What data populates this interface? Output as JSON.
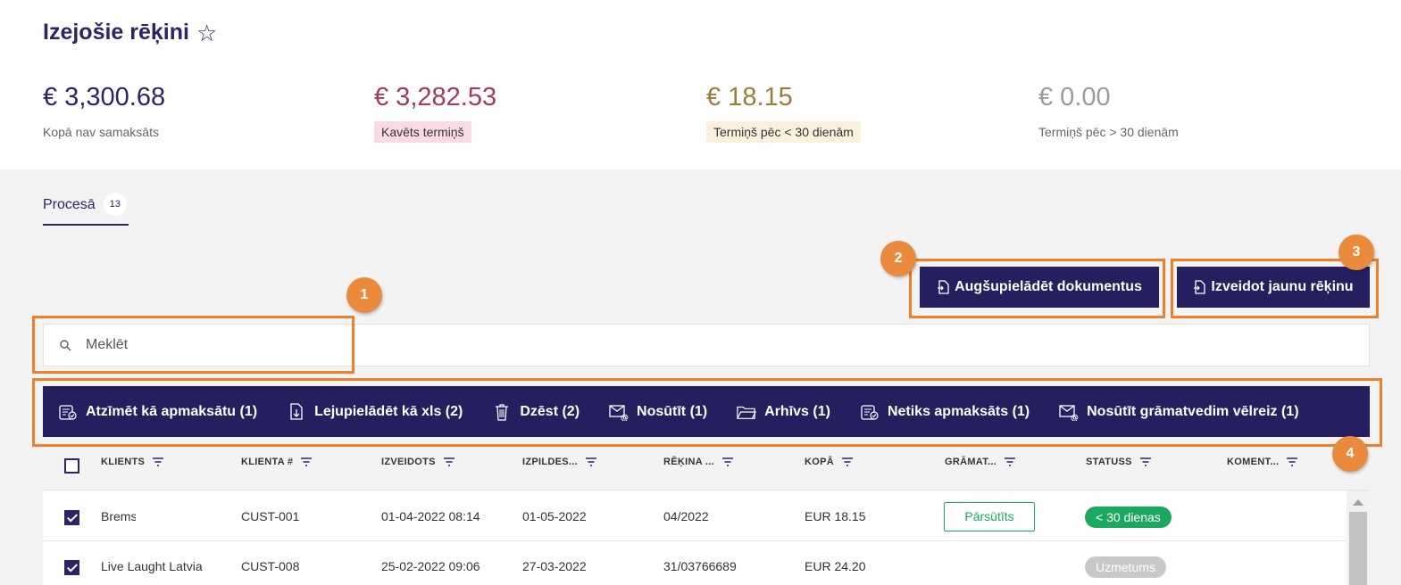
{
  "page": {
    "title": "Izejošie rēķini",
    "favorite_icon": "star-outline-icon"
  },
  "stats": [
    {
      "amount": "€ 3,300.68",
      "label": "Kopā nav samaksāts"
    },
    {
      "amount": "€ 3,282.53",
      "label": "Kavēts termiņš",
      "color": "#a33c52",
      "badge_bg": "#fadbe3"
    },
    {
      "amount": "€ 18.15",
      "label": "Termiņš pēc < 30 dienām",
      "color": "#9a7d3a",
      "badge_bg": "#fbf0dc"
    },
    {
      "amount": "€ 0.00",
      "label": "Termiņš pēc > 30 dienām"
    }
  ],
  "tabs": [
    {
      "label": "Procesā",
      "count": "13"
    }
  ],
  "buttons": {
    "upload": "Augšupielādēt dokumentus",
    "create": "Izveidot jaunu rēķinu"
  },
  "search": {
    "placeholder": "Meklēt"
  },
  "actions": [
    {
      "label": "Atzīmēt kā apmaksātu (1)",
      "icon": "mark-paid-icon"
    },
    {
      "label": "Lejupielādēt kā xls (2)",
      "icon": "download-xls-icon"
    },
    {
      "label": "Dzēst (2)",
      "icon": "trash-icon"
    },
    {
      "label": "Nosūtīt (1)",
      "icon": "email-send-icon"
    },
    {
      "label": "Arhīvs (1)",
      "icon": "folder-icon"
    },
    {
      "label": "Netiks apmaksāts (1)",
      "icon": "not-paid-icon"
    },
    {
      "label": "Nosūtīt grāmatvedim vēlreiz (1)",
      "icon": "email-resend-icon"
    }
  ],
  "table": {
    "columns": [
      "KLIENTS",
      "KLIENTA #",
      "IZVEIDOTS",
      "IZPILDES...",
      "RĒĶINA ...",
      "KOPĀ",
      "GRĀMAT...",
      "STATUSS",
      "KOMENT..."
    ],
    "rows": [
      {
        "checked": true,
        "client": "Brems",
        "client_no": "CUST-001",
        "created": "01-04-2022 08:14",
        "due": "01-05-2022",
        "invoice": "04/2022",
        "total": "EUR 18.15",
        "accounting": "Pārsūtīts",
        "status": "< 30 dienas",
        "status_color": "#1da862",
        "comment": ""
      },
      {
        "checked": true,
        "client": "Live Laught Latvia",
        "client_no": "CUST-008",
        "created": "25-02-2022 09:06",
        "due": "27-03-2022",
        "invoice": "31/03766689",
        "total": "EUR 24.20",
        "accounting": "",
        "status": "Uzmetums",
        "status_color": "#c8c8c8",
        "comment": ""
      }
    ]
  },
  "annotations": [
    "1",
    "2",
    "3",
    "4"
  ],
  "colors": {
    "primary": "#251f60",
    "highlight": "#f07f2a",
    "marker": "#e98a3c",
    "success": "#1da862"
  }
}
